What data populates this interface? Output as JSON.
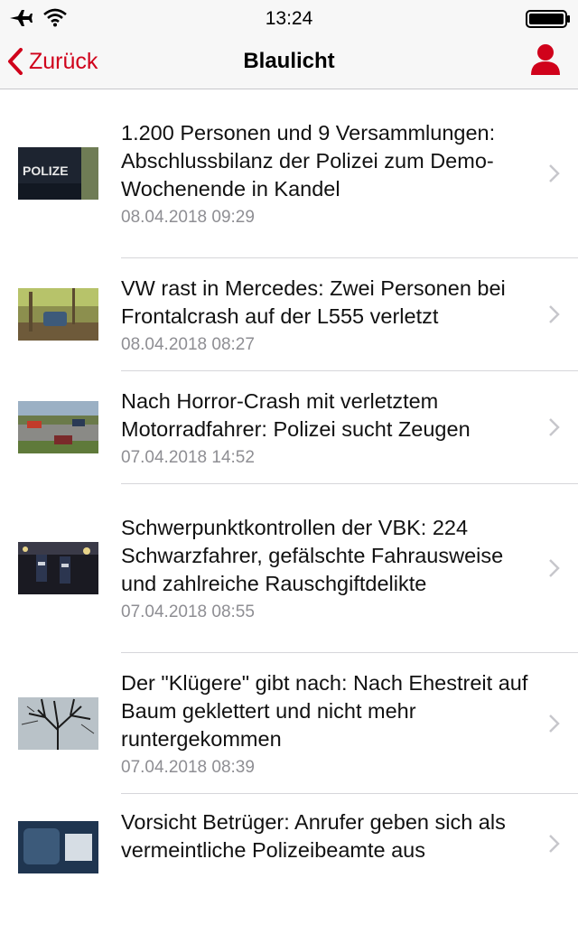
{
  "status_bar": {
    "time": "13:24"
  },
  "nav": {
    "back_label": "Zurück",
    "title": "Blaulicht"
  },
  "colors": {
    "accent": "#d0021b",
    "date_gray": "#8e8e93"
  },
  "articles": [
    {
      "title": "1.200 Personen und 9 Versammlungen: Abschlussbilanz der Polizei zum Demo-Wochenende in Kandel",
      "date": "08.04.2018 09:29",
      "thumb_text": "POLIZE"
    },
    {
      "title": "VW rast in Mercedes: Zwei Personen bei Frontalcrash auf der L555 verletzt",
      "date": "08.04.2018 08:27"
    },
    {
      "title": "Nach Horror-Crash mit verletztem Motorradfahrer: Polizei sucht Zeugen",
      "date": "07.04.2018 14:52"
    },
    {
      "title": "Schwerpunktkontrollen der VBK: 224 Schwarzfahrer, gefälschte Fahrausweise und zahlreiche Rauschgiftdelikte",
      "date": "07.04.2018 08:55"
    },
    {
      "title": "Der \"Klügere\" gibt nach: Nach Ehestreit auf Baum geklettert und nicht mehr runtergekommen",
      "date": "07.04.2018 08:39"
    },
    {
      "title": "Vorsicht Betrüger: Anrufer geben sich als vermeintliche Polizeibeamte aus",
      "date": ""
    }
  ]
}
